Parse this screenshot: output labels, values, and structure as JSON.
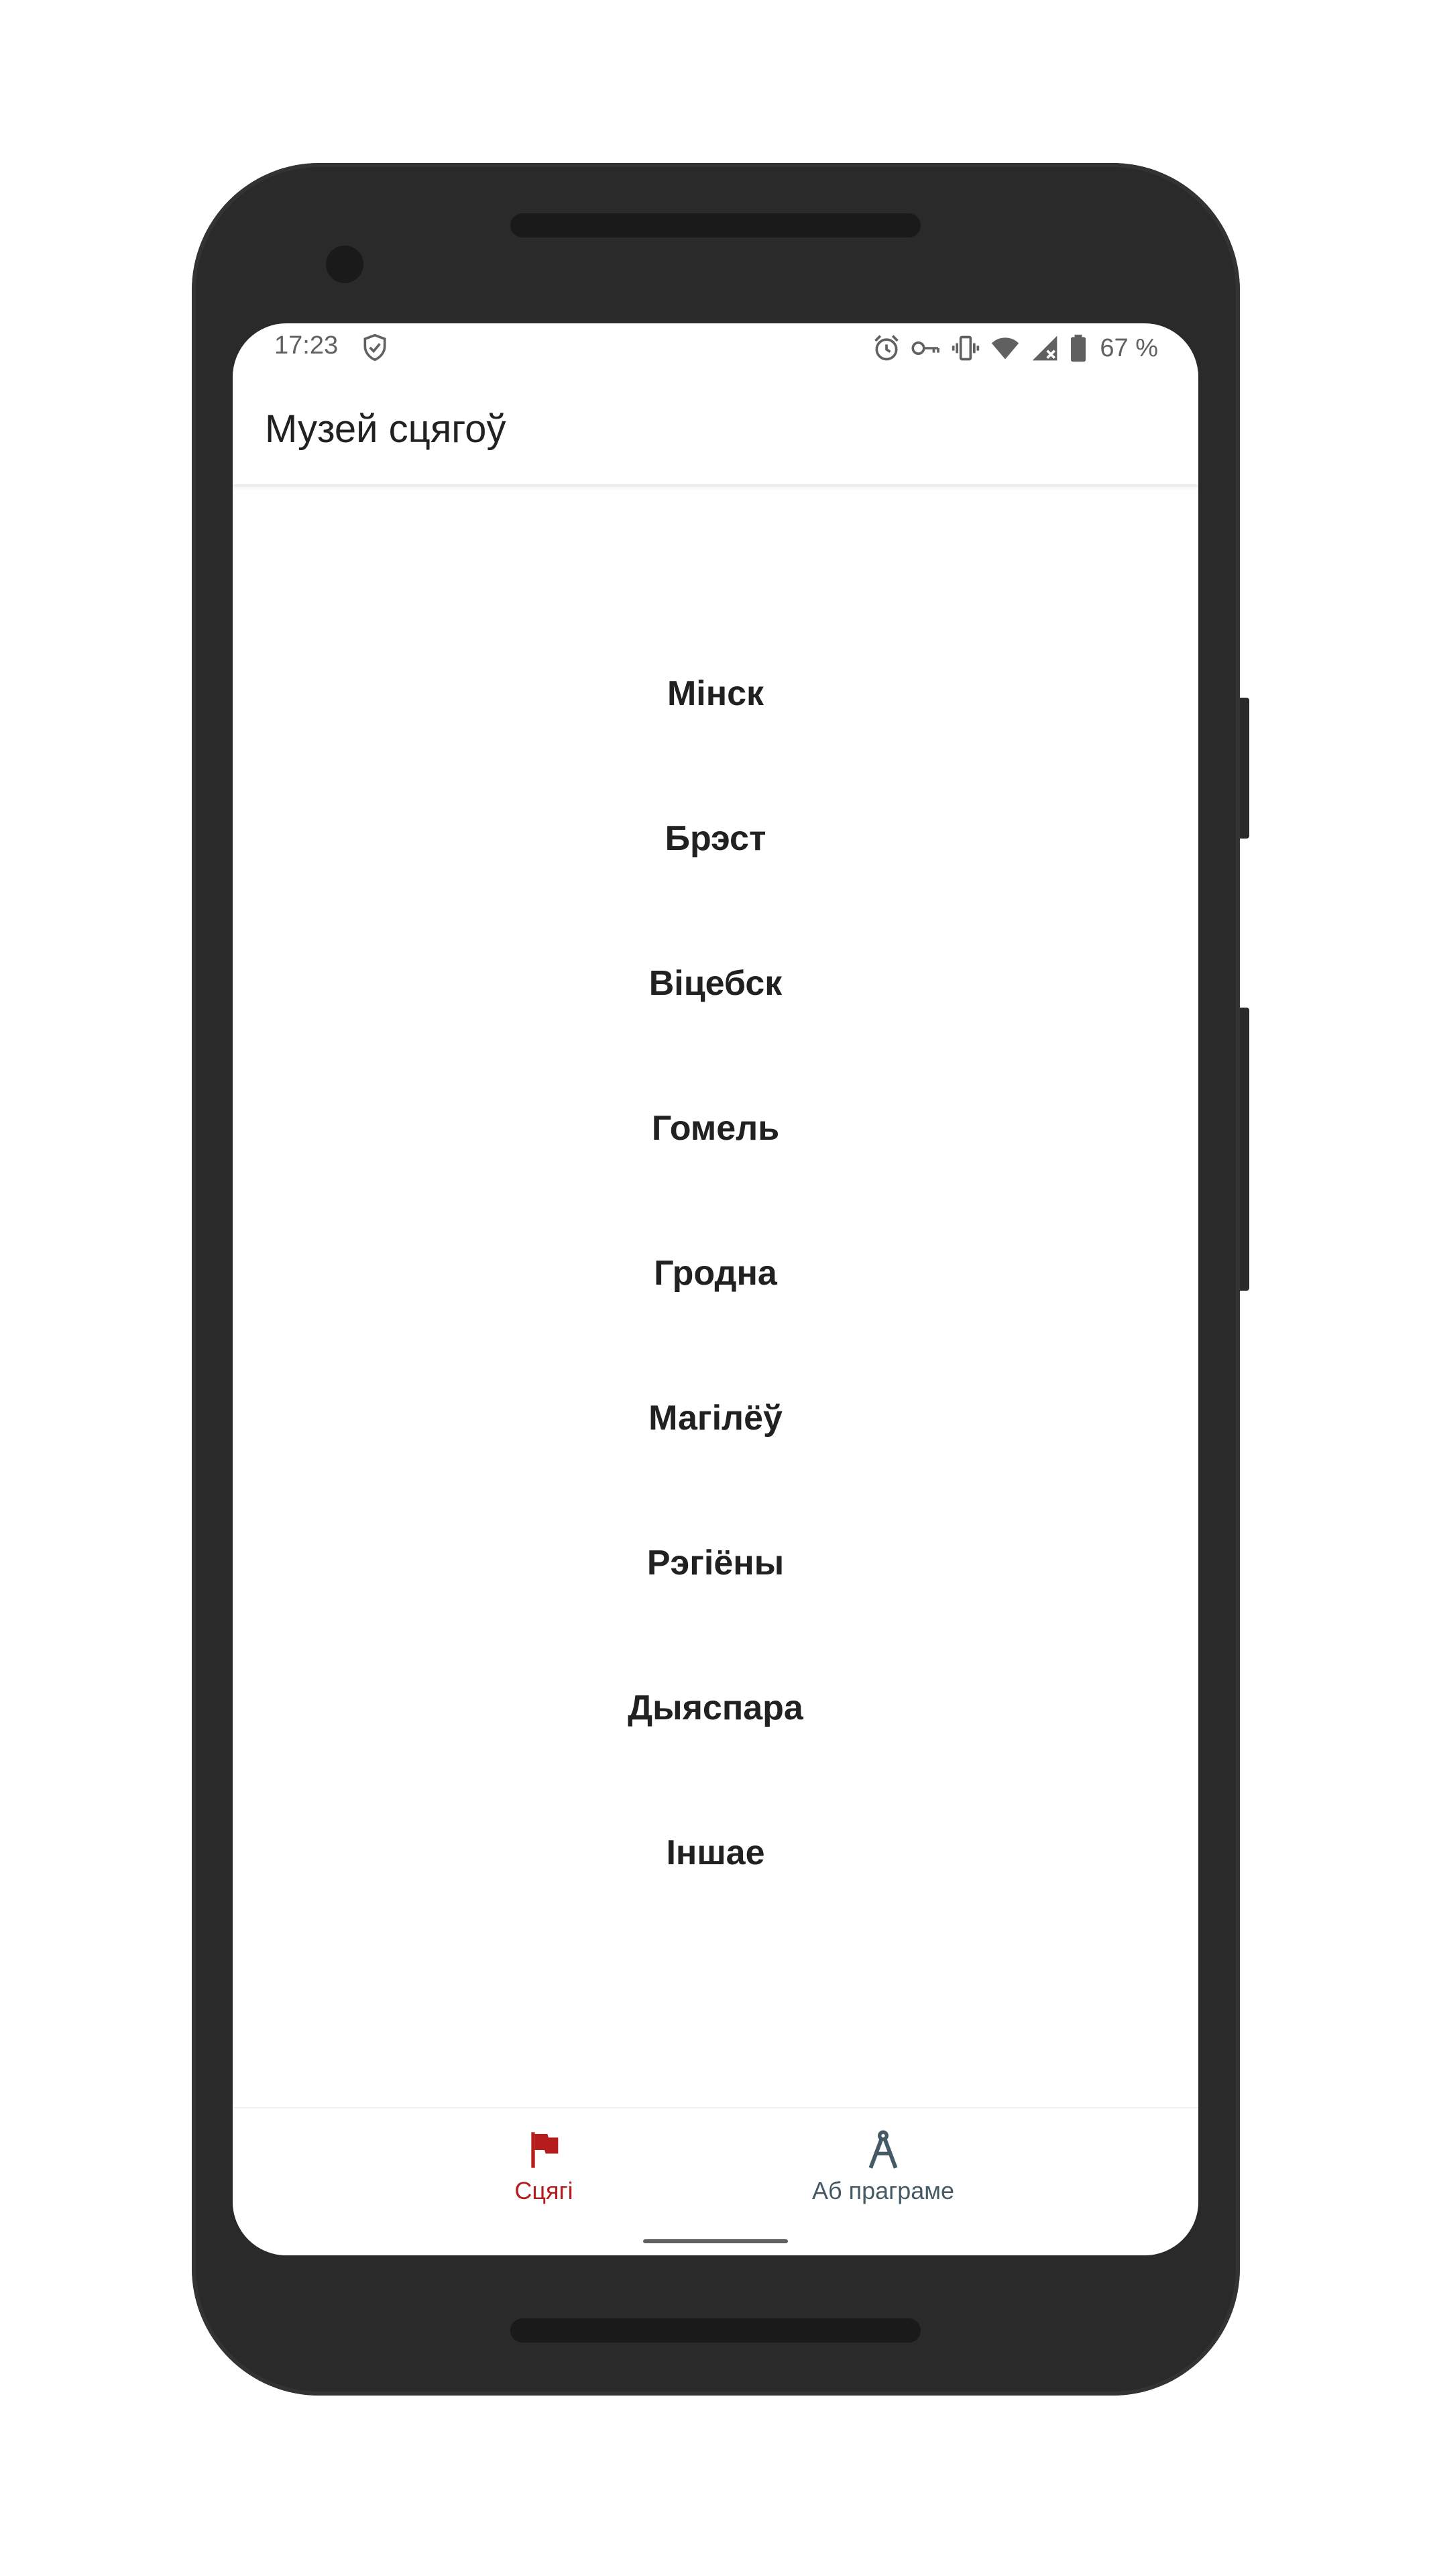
{
  "status_bar": {
    "time": "17:23",
    "battery": "67 %",
    "icons": [
      "shield-check-icon",
      "alarm-icon",
      "vpn-key-icon",
      "vibrate-icon",
      "wifi-icon",
      "signal-icon",
      "battery-icon"
    ]
  },
  "app_bar": {
    "title": "Музей сцягоў"
  },
  "list": {
    "items": [
      {
        "label": "Мінск"
      },
      {
        "label": "Брэст"
      },
      {
        "label": "Віцебск"
      },
      {
        "label": "Гомель"
      },
      {
        "label": "Гродна"
      },
      {
        "label": "Магілёў"
      },
      {
        "label": "Рэгіёны"
      },
      {
        "label": "Дыяспара"
      },
      {
        "label": "Іншае"
      }
    ]
  },
  "bottom_nav": {
    "items": [
      {
        "label": "Сцягі",
        "icon": "flag-icon",
        "active": true
      },
      {
        "label": "Аб праграме",
        "icon": "compass-icon",
        "active": false
      }
    ]
  },
  "colors": {
    "accent": "#b71c1c",
    "text": "#212121",
    "inactive": "#455a64",
    "frame": "#2a2a2a"
  }
}
